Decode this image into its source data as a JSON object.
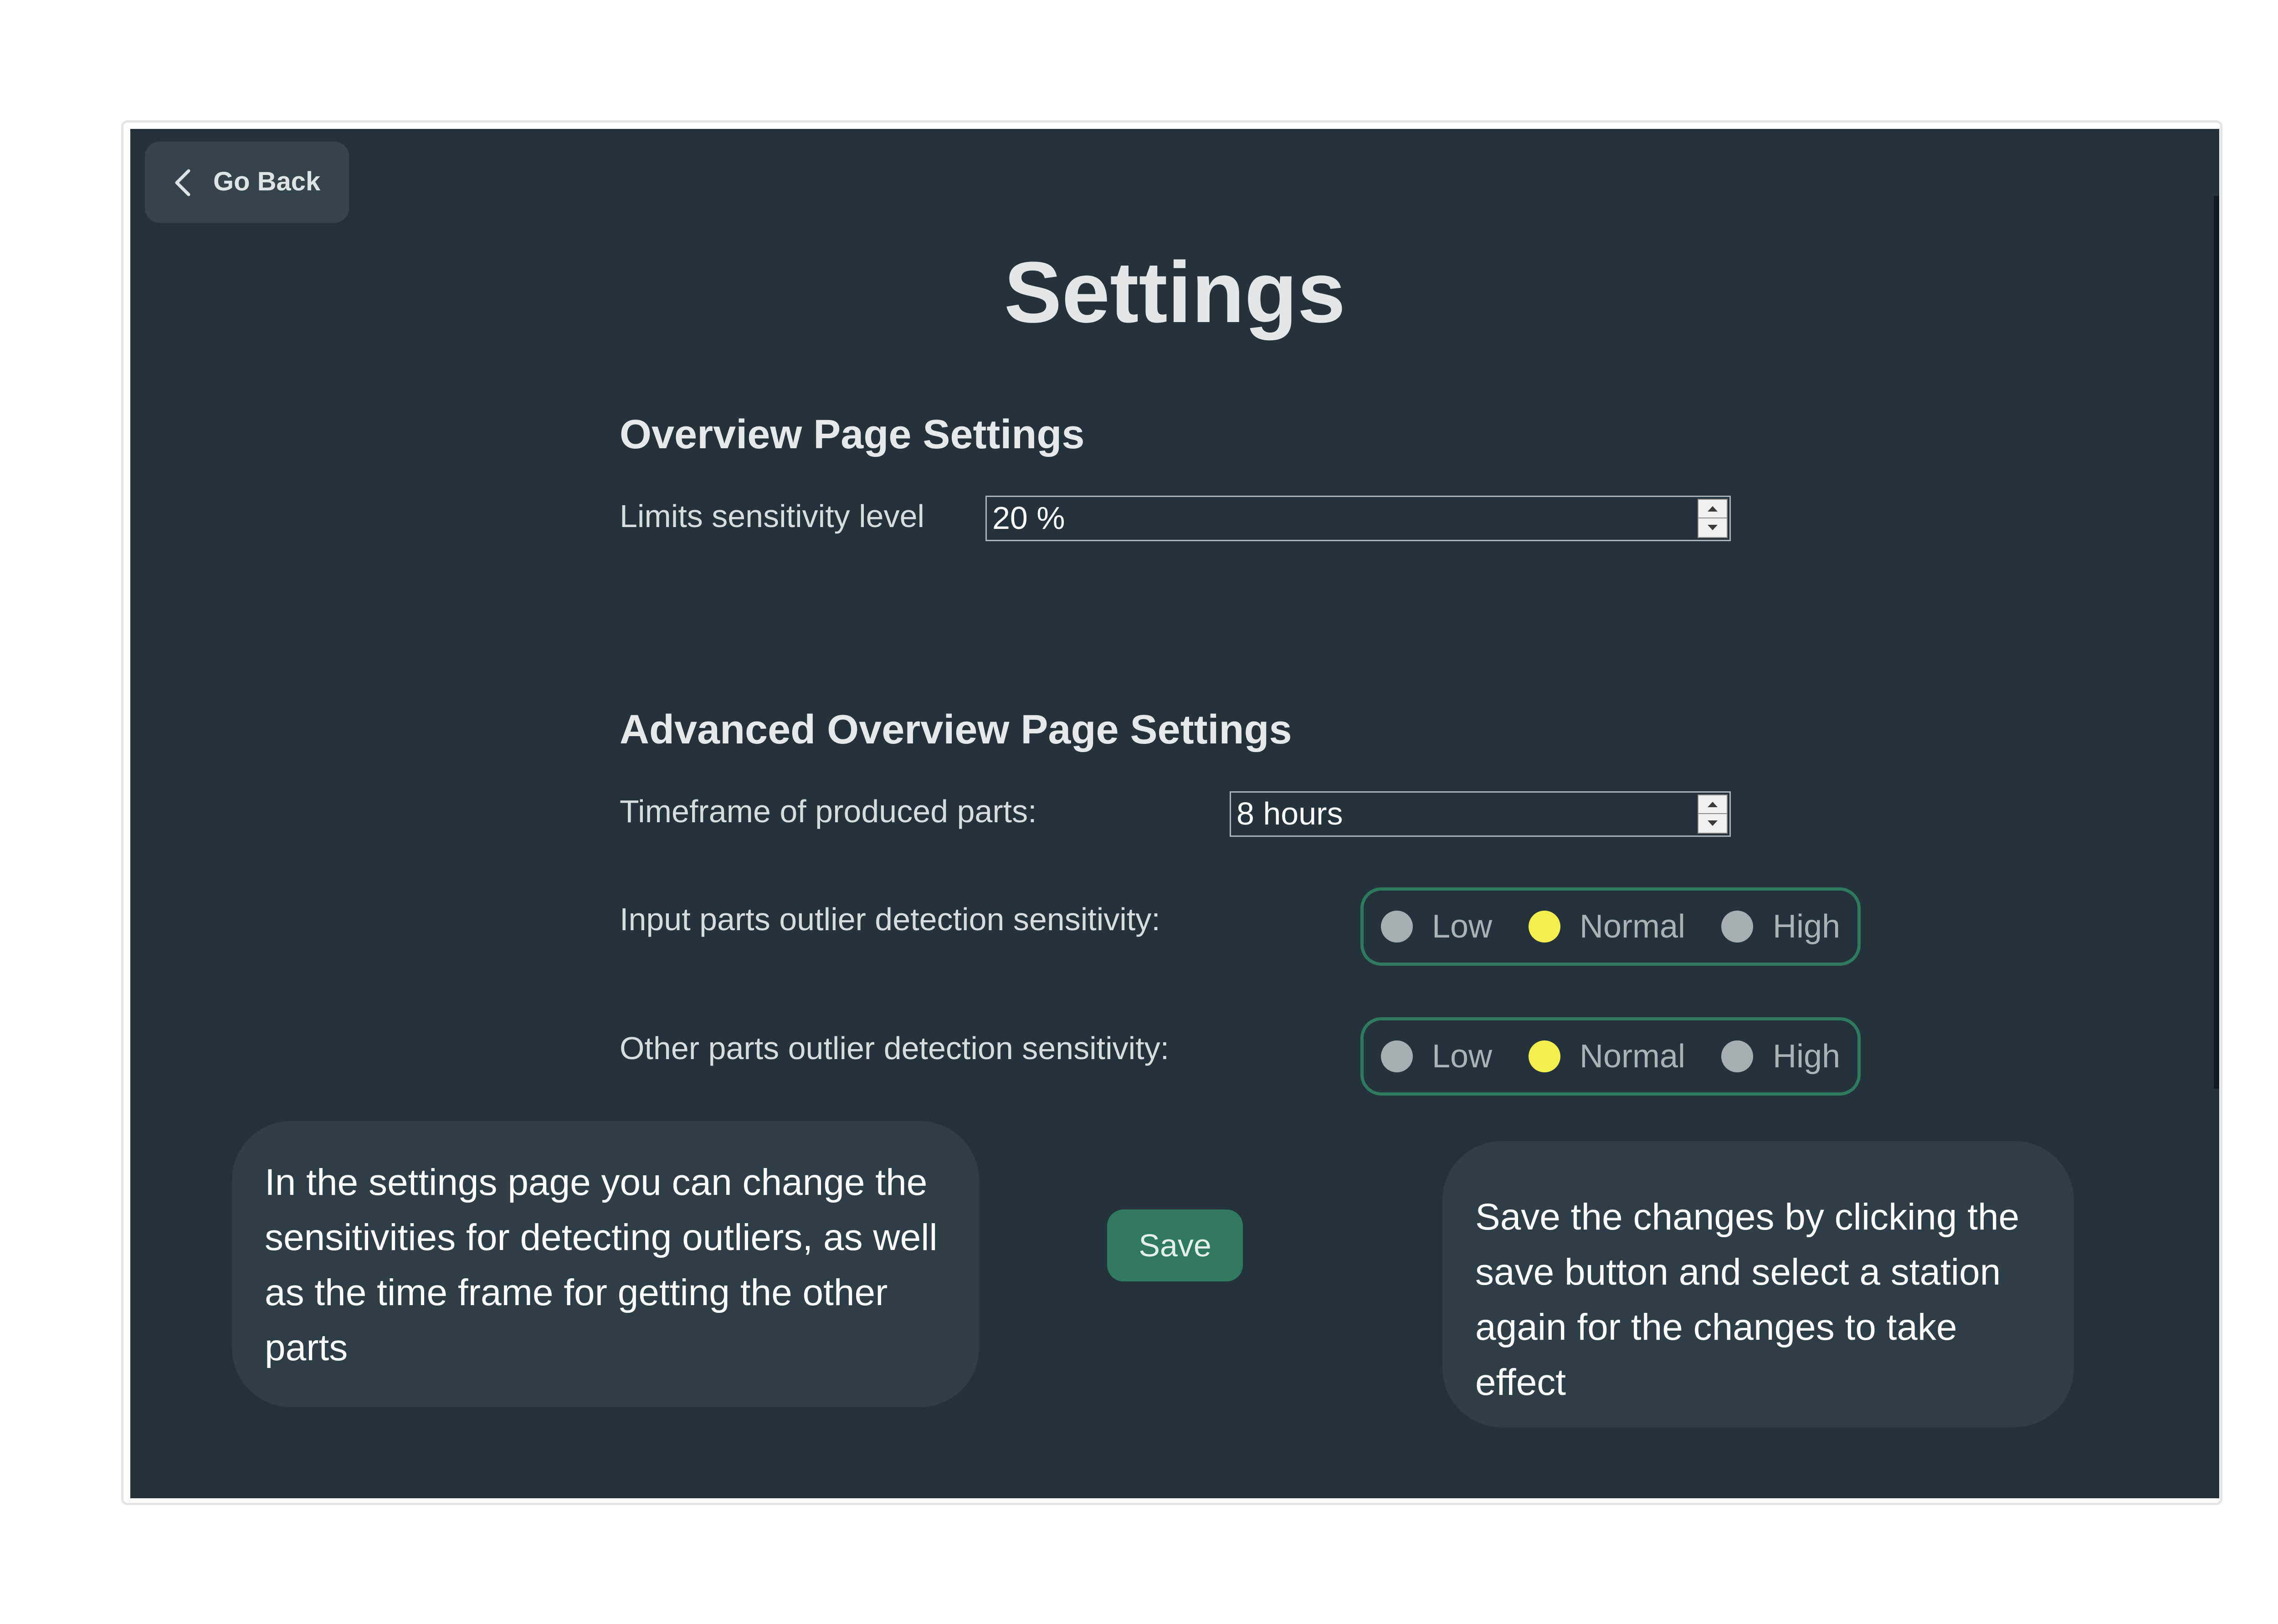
{
  "header": {
    "back_label": "Go Back",
    "title": "Settings"
  },
  "overview": {
    "heading": "Overview Page Settings",
    "limits_label": "Limits sensitivity level",
    "limits_value": "20 %"
  },
  "advanced": {
    "heading": "Advanced Overview Page Settings",
    "timeframe_label": "Timeframe of produced parts:",
    "timeframe_value": "8 hours",
    "input_label": "Input parts outlier detection sensitivity:",
    "other_label": "Other parts outlier detection sensitivity:",
    "options": [
      "Low",
      "Normal",
      "High"
    ],
    "input_selected": "Normal",
    "other_selected": "Normal"
  },
  "actions": {
    "save_label": "Save"
  },
  "callouts": {
    "left": "In the settings page you can change the sensitivities for detecting outliers, as well as the time frame for getting the other parts",
    "right": "Save the changes by clicking the save button and select a station again for the changes to take effect"
  },
  "colors": {
    "background": "#24333b",
    "accent": "#2f7a5e",
    "selected_radio": "#f5ee4f",
    "unselected_radio": "#a7aeb1"
  }
}
